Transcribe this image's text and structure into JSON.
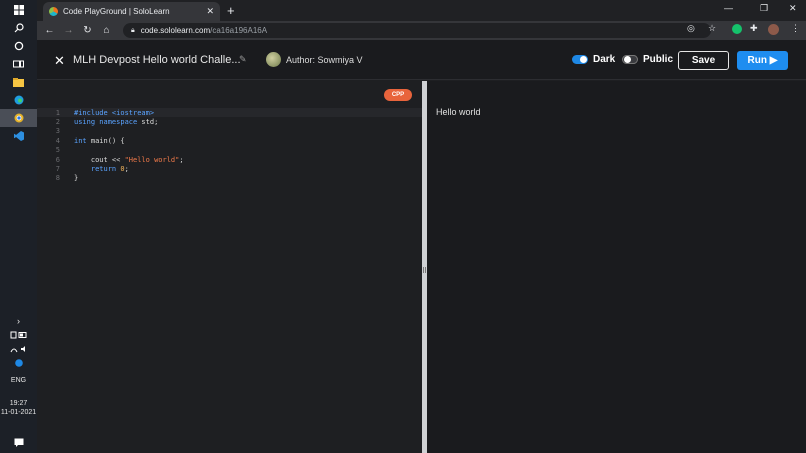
{
  "taskbar": {
    "icons": [
      "windows-icon",
      "search-icon",
      "cortana-icon",
      "task-view-icon",
      "file-explorer-icon",
      "edge-icon",
      "chrome-icon",
      "vscode-icon"
    ],
    "language": "ENG",
    "time": "19:27",
    "date": "11-01-2021"
  },
  "browser": {
    "tab_title": "Code PlayGround | SoloLearn",
    "url_host": "code.sololearn.com",
    "url_path": "/ca16a196A16A"
  },
  "app": {
    "title": "MLH Devpost Hello world Challe...",
    "author": "Author: Sowmiya V",
    "dark_label": "Dark",
    "dark_on": true,
    "public_label": "Public",
    "public_on": false,
    "save_label": "Save",
    "run_label": "Run ▶",
    "language_badge": "CPP",
    "colors": {
      "run_button": "#1e8df0",
      "badge": "#e8643c",
      "toggle_on": "#1e88e5"
    }
  },
  "code": {
    "line_numbers": [
      "1",
      "2",
      "3",
      "4",
      "5",
      "6",
      "7",
      "8"
    ],
    "lines": {
      "l1": "#include <iostream>",
      "l2a": "using namespace",
      "l2b": " std;",
      "l4a": "int",
      "l4b": " main() {",
      "l6a": "    cout << ",
      "l6b": "\"Hello world\"",
      "l6c": ";",
      "l7a": "    return ",
      "l7b": "0",
      "l7c": ";",
      "l8": "}"
    }
  },
  "output": {
    "text": "Hello world"
  }
}
